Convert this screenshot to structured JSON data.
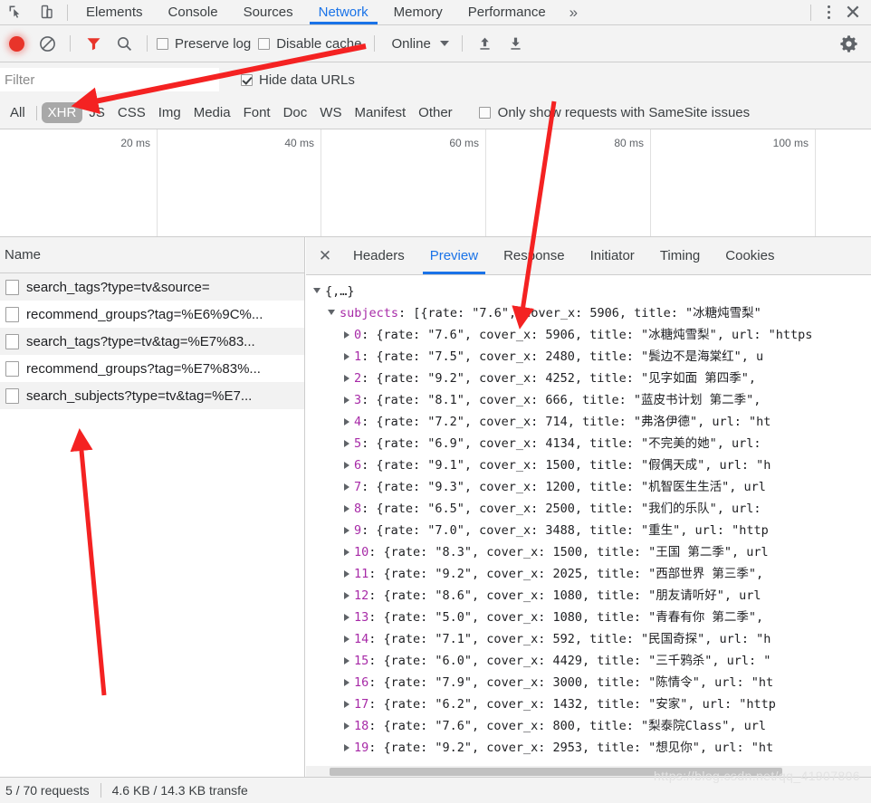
{
  "window": {
    "tabs": [
      {
        "label": "Elements",
        "active": false
      },
      {
        "label": "Console",
        "active": false
      },
      {
        "label": "Sources",
        "active": false
      },
      {
        "label": "Network",
        "active": true
      },
      {
        "label": "Memory",
        "active": false
      },
      {
        "label": "Performance",
        "active": false
      }
    ],
    "more_label": "»",
    "close_label": "✕",
    "accent_color": "#1a73e8",
    "icons": {
      "inspect": "inspect-element-icon",
      "device": "device-toolbar-icon",
      "kebab": "more-options-icon"
    }
  },
  "toolbar": {
    "record_title": "record-button",
    "clear_title": "clear-button",
    "filter_title": "filter-button",
    "search_title": "search-button",
    "preserve_log": {
      "label": "Preserve log",
      "checked": false
    },
    "disable_cache": {
      "label": "Disable cache",
      "checked": false
    },
    "throttling": {
      "value": "Online"
    },
    "import_title": "import-har-button",
    "export_title": "export-har-button",
    "settings_title": "settings-gear"
  },
  "filterbar": {
    "input_value": "",
    "input_placeholder": "Filter",
    "hide_data_urls": {
      "label": "Hide data URLs",
      "checked": true
    }
  },
  "typefilters": {
    "chips": [
      {
        "label": "All",
        "active": false
      },
      {
        "label": "XHR",
        "active": true
      },
      {
        "label": "JS",
        "active": false
      },
      {
        "label": "CSS",
        "active": false
      },
      {
        "label": "Img",
        "active": false
      },
      {
        "label": "Media",
        "active": false
      },
      {
        "label": "Font",
        "active": false
      },
      {
        "label": "Doc",
        "active": false
      },
      {
        "label": "WS",
        "active": false
      },
      {
        "label": "Manifest",
        "active": false
      },
      {
        "label": "Other",
        "active": false
      }
    ],
    "samesite": {
      "label": "Only show requests with SameSite issues",
      "checked": false
    }
  },
  "overview": {
    "ticks": [
      "20 ms",
      "40 ms",
      "60 ms",
      "80 ms",
      "100 ms"
    ]
  },
  "requests": {
    "column_header": "Name",
    "rows": [
      {
        "name": "search_tags?type=tv&source="
      },
      {
        "name": "recommend_groups?tag=%E6%9C%..."
      },
      {
        "name": "search_tags?type=tv&tag=%E7%83..."
      },
      {
        "name": "recommend_groups?tag=%E7%83%..."
      },
      {
        "name": "search_subjects?type=tv&tag=%E7..."
      }
    ]
  },
  "detail": {
    "close_label": "✕",
    "tabs": [
      {
        "label": "Headers",
        "active": false
      },
      {
        "label": "Preview",
        "active": true
      },
      {
        "label": "Response",
        "active": false
      },
      {
        "label": "Initiator",
        "active": false
      },
      {
        "label": "Timing",
        "active": false
      },
      {
        "label": "Cookies",
        "active": false
      }
    ]
  },
  "preview": {
    "root_label": "{,…}",
    "array_key": "subjects",
    "array_head": ": [{rate: \"7.6\", cover_x: 5906, title: \"冰糖炖雪梨\"",
    "items": [
      {
        "index": "0",
        "text": ": {rate: \"7.6\", cover_x: 5906, title: \"冰糖炖雪梨\", url: \"https"
      },
      {
        "index": "1",
        "text": ": {rate: \"7.5\", cover_x: 2480, title: \"鬓边不是海棠红\", u"
      },
      {
        "index": "2",
        "text": ": {rate: \"9.2\", cover_x: 4252, title: \"见字如面 第四季\", "
      },
      {
        "index": "3",
        "text": ": {rate: \"8.1\", cover_x: 666, title: \"蓝皮书计划 第二季\", "
      },
      {
        "index": "4",
        "text": ": {rate: \"7.2\", cover_x: 714, title: \"弗洛伊德\", url: \"ht"
      },
      {
        "index": "5",
        "text": ": {rate: \"6.9\", cover_x: 4134, title: \"不完美的她\", url: "
      },
      {
        "index": "6",
        "text": ": {rate: \"9.1\", cover_x: 1500, title: \"假偶天成\", url: \"h"
      },
      {
        "index": "7",
        "text": ": {rate: \"9.3\", cover_x: 1200, title: \"机智医生生活\", url"
      },
      {
        "index": "8",
        "text": ": {rate: \"6.5\", cover_x: 2500, title: \"我们的乐队\", url: "
      },
      {
        "index": "9",
        "text": ": {rate: \"7.0\", cover_x: 3488, title: \"重生\", url: \"http"
      },
      {
        "index": "10",
        "text": ": {rate: \"8.3\", cover_x: 1500, title: \"王国 第二季\", url"
      },
      {
        "index": "11",
        "text": ": {rate: \"9.2\", cover_x: 2025, title: \"西部世界 第三季\","
      },
      {
        "index": "12",
        "text": ": {rate: \"8.6\", cover_x: 1080, title: \"朋友请听好\", url"
      },
      {
        "index": "13",
        "text": ": {rate: \"5.0\", cover_x: 1080, title: \"青春有你 第二季\","
      },
      {
        "index": "14",
        "text": ": {rate: \"7.1\", cover_x: 592, title: \"民国奇探\", url: \"h"
      },
      {
        "index": "15",
        "text": ": {rate: \"6.0\", cover_x: 4429, title: \"三千鸦杀\", url: \""
      },
      {
        "index": "16",
        "text": ": {rate: \"7.9\", cover_x: 3000, title: \"陈情令\", url: \"ht"
      },
      {
        "index": "17",
        "text": ": {rate: \"6.2\", cover_x: 1432, title: \"安家\", url: \"http"
      },
      {
        "index": "18",
        "text": ": {rate: \"7.6\", cover_x: 800, title: \"梨泰院Class\", url"
      },
      {
        "index": "19",
        "text": ": {rate: \"9.2\", cover_x: 2953, title: \"想见你\", url: \"ht"
      }
    ]
  },
  "statusbar": {
    "requests": "5 / 70 requests",
    "transferred": "4.6 KB / 14.3 KB transfe"
  },
  "watermark": "https://blog.csdn.net/qq_41907806"
}
